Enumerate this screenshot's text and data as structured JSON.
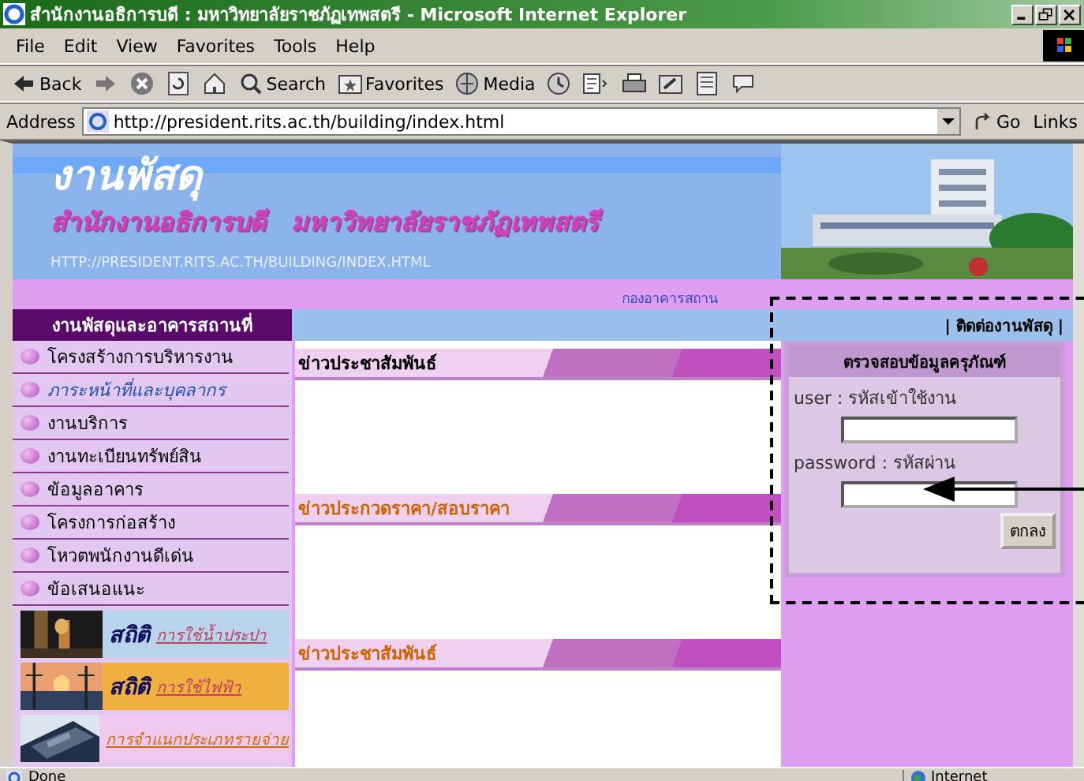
{
  "window": {
    "title": "สำนักงานอธิการบดี : มหาวิทยาลัยราชภัฏเทพสตรี - Microsoft Internet Explorer"
  },
  "menu": [
    "File",
    "Edit",
    "View",
    "Favorites",
    "Tools",
    "Help"
  ],
  "toolbar": [
    {
      "kind": "back",
      "label": "Back"
    },
    {
      "kind": "forward"
    },
    {
      "kind": "stop"
    },
    {
      "kind": "refresh"
    },
    {
      "kind": "home"
    },
    {
      "kind": "search",
      "label": "Search"
    },
    {
      "kind": "favorites",
      "label": "Favorites"
    },
    {
      "kind": "media",
      "label": "Media"
    },
    {
      "kind": "history"
    },
    {
      "kind": "mail"
    },
    {
      "kind": "print"
    },
    {
      "kind": "edit"
    },
    {
      "kind": "discuss"
    },
    {
      "kind": "messenger"
    }
  ],
  "address": {
    "label": "Address",
    "url": "http://president.rits.ac.th/building/index.html",
    "go": "Go",
    "links": "Links"
  },
  "banner": {
    "title": "งานพัสดุ",
    "subtitle": "สำนักงานอธิการบดี   มหาวิทยาลัยราชภัฏเทพสตรี",
    "url": "HTTP://PRESIDENT.RITS.AC.TH/BUILDING/INDEX.HTML"
  },
  "top_link": "กองอาคารสถาน",
  "sidebar": {
    "heading": "งานพัสดุและอาคารสถานที่",
    "items": [
      {
        "label": "โครงสร้างการบริหารงาน",
        "visited": false
      },
      {
        "label": "ภาระหน้าที่และบุคลากร",
        "visited": true
      },
      {
        "label": "งานบริการ",
        "visited": false
      },
      {
        "label": "งานทะเบียนทรัพย์สิน",
        "visited": false
      },
      {
        "label": "ข้อมูลอาคาร",
        "visited": false
      },
      {
        "label": "โครงการก่อสร้าง",
        "visited": false
      },
      {
        "label": "โหวตพนักงานดีเด่น",
        "visited": false
      },
      {
        "label": "ข้อเสนอแนะ",
        "visited": false
      }
    ],
    "banners": [
      {
        "title": "สถิติ",
        "caption": "การใช้น้ำประปา"
      },
      {
        "title": "สถิติ",
        "caption": "การใช้ไฟฟ้า"
      },
      {
        "caption": "การจำแนกประเภทรายจ่าย"
      }
    ]
  },
  "contact_link": "| ติดต่องานพัสดุ |",
  "sections": [
    {
      "title": "ข่าวประชาสัมพันธ์",
      "color": "#000000"
    },
    {
      "title": "ข่าวประกวดราคา/สอบราคา",
      "color": "#cc6600"
    },
    {
      "title": "ข่าวประชาสัมพันธ์",
      "color": "#cc6600"
    }
  ],
  "login": {
    "title": "ตรวจสอบข้อมูลครุภัณฑ์",
    "fields": [
      {
        "label": "user : รหัสเข้าใช้งาน"
      },
      {
        "label": "password : รหัสผ่าน"
      }
    ],
    "button": "ตกลง"
  },
  "status_bar": {
    "text": "Done",
    "zone": "Internet"
  }
}
